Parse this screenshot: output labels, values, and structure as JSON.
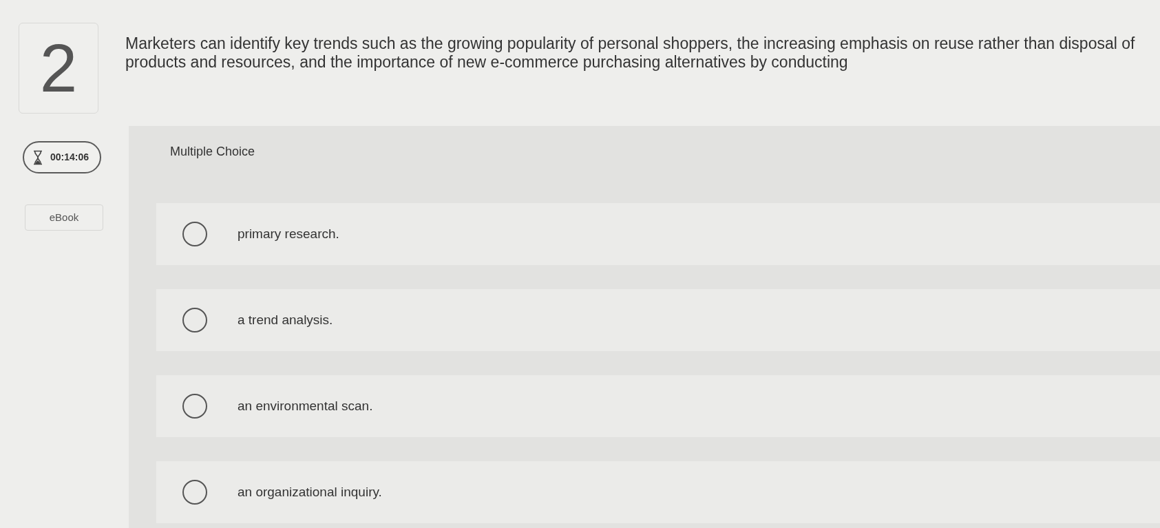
{
  "question": {
    "number": "2",
    "text": "Marketers can identify key trends such as the growing popularity of personal shoppers, the increasing emphasis on reuse rather than disposal of products and resources, and the importance of new e-commerce purchasing alternatives by conducting"
  },
  "timer": {
    "time": "00:14:06"
  },
  "ebook": {
    "label": "eBook"
  },
  "answer_panel": {
    "title": "Multiple Choice",
    "options": [
      {
        "label": "primary research.",
        "selected": false
      },
      {
        "label": "a trend analysis.",
        "selected": false
      },
      {
        "label": "an environmental scan.",
        "selected": false
      },
      {
        "label": "an organizational inquiry.",
        "selected": false
      }
    ]
  }
}
